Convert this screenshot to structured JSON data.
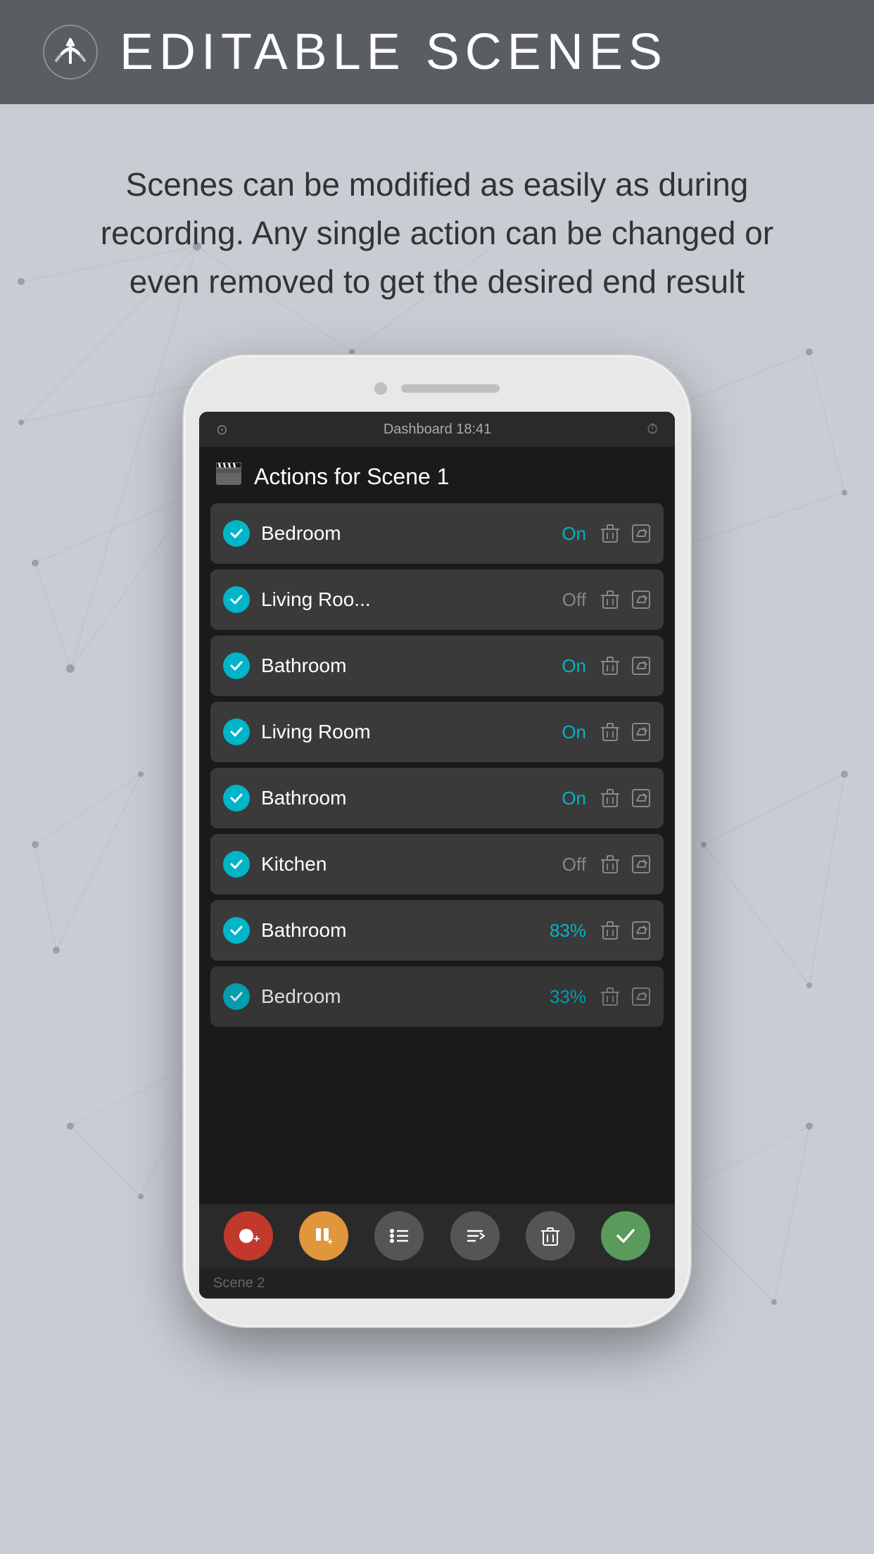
{
  "header": {
    "title": "EDITABLE SCENES",
    "logo_alt": "app-logo"
  },
  "description": {
    "text": "Scenes can be modified as easily as during recording. Any single action can be changed or even removed to get the desired end result"
  },
  "phone": {
    "status_bar": {
      "left": "◉",
      "center": "Dashboard    18:41",
      "right": "⏰"
    },
    "scene_header": {
      "title": "Actions for Scene 1",
      "icon": "🎬"
    },
    "actions": [
      {
        "name": "Bedroom",
        "status": "On",
        "status_type": "on"
      },
      {
        "name": "Living Roo...",
        "status": "Off",
        "status_type": "off"
      },
      {
        "name": "Bathroom",
        "status": "On",
        "status_type": "on"
      },
      {
        "name": "Living Room",
        "status": "On",
        "status_type": "on"
      },
      {
        "name": "Bathroom",
        "status": "On",
        "status_type": "on"
      },
      {
        "name": "Kitchen",
        "status": "Off",
        "status_type": "off"
      },
      {
        "name": "Bathroom",
        "status": "83%",
        "status_type": "pct"
      },
      {
        "name": "Bedroom",
        "status": "33%",
        "status_type": "pct"
      }
    ],
    "toolbar": {
      "buttons": [
        {
          "label": "⬤+",
          "type": "record"
        },
        {
          "label": "⏸+",
          "type": "pause"
        },
        {
          "label": "☰",
          "type": "list"
        },
        {
          "label": "↵",
          "type": "add-list"
        },
        {
          "label": "🗑",
          "type": "trash"
        },
        {
          "label": "✓",
          "type": "check-done"
        }
      ]
    },
    "bottom_label": "Scene 2"
  }
}
